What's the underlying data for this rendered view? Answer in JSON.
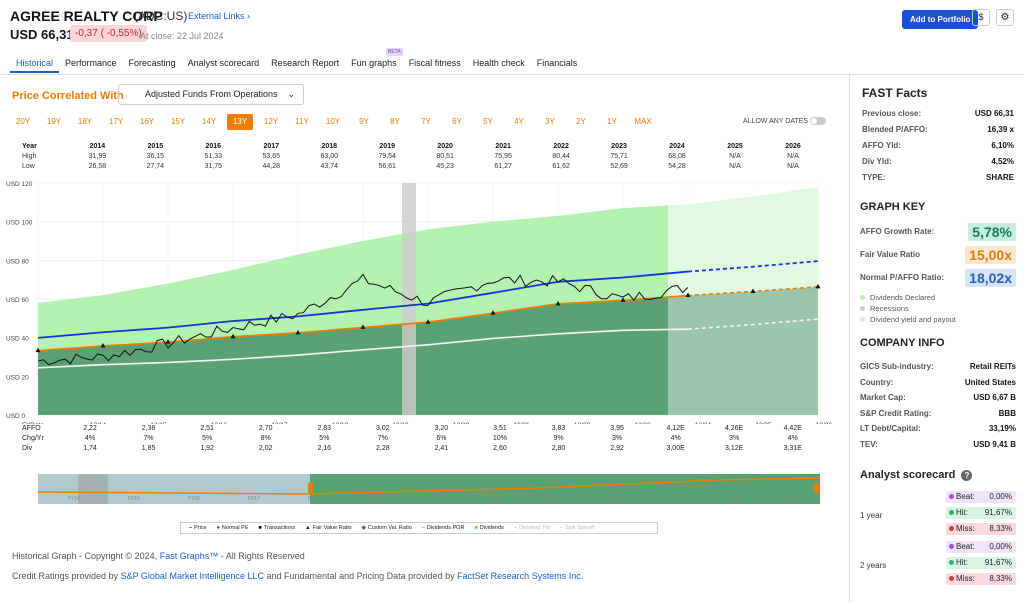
{
  "header": {
    "company": "AGREE REALTY CORP",
    "ticker": "(ADC:US)",
    "external_links": "External Links ›",
    "price": "USD 66,31",
    "change": "-0,37 ( -0,55%)",
    "close": "At close: 22 Jul 2024",
    "add_portfolio": "Add to Portfolio",
    "dollar": "$",
    "gear": "⚙"
  },
  "tabs": [
    {
      "label": "Historical"
    },
    {
      "label": "Performance"
    },
    {
      "label": "Forecasting"
    },
    {
      "label": "Analyst scorecard"
    },
    {
      "label": "Research Report"
    },
    {
      "label": "Fun graphs",
      "badge": "BETA"
    },
    {
      "label": "Fiscal fitness"
    },
    {
      "label": "Health check"
    },
    {
      "label": "Financials"
    }
  ],
  "chartctl": {
    "title": "Price Correlated With",
    "metric": "Adjusted Funds From Operations",
    "years": [
      "20Y",
      "19Y",
      "18Y",
      "17Y",
      "16Y",
      "15Y",
      "14Y",
      "13Y",
      "12Y",
      "11Y",
      "10Y",
      "9Y",
      "8Y",
      "7Y",
      "6Y",
      "5Y",
      "4Y",
      "3Y",
      "2Y",
      "1Y",
      "MAX"
    ],
    "selected": "13Y",
    "allow": "ALLOW ANY DATES"
  },
  "year_table": {
    "labels": [
      "Year",
      "High",
      "Low"
    ],
    "years": [
      "2014",
      "2015",
      "2016",
      "2017",
      "2018",
      "2019",
      "2020",
      "2021",
      "2022",
      "2023",
      "2024",
      "2025",
      "2026"
    ],
    "high": [
      "31,99",
      "36,15",
      "51,33",
      "53,65",
      "63,00",
      "79,54",
      "80,51",
      "75,95",
      "80,44",
      "75,71",
      "68,08",
      "N/A",
      "N/A"
    ],
    "low": [
      "26,58",
      "27,74",
      "31,75",
      "44,28",
      "43,74",
      "56,61",
      "45,23",
      "61,27",
      "61,62",
      "52,69",
      "54,28",
      "N/A",
      "N/A"
    ]
  },
  "chart_data": {
    "type": "line",
    "yaxis": [
      "USD 120",
      "USD 100",
      "USD 80",
      "USD 60",
      "USD 40",
      "USD 20",
      "USD 0"
    ],
    "ylim": [
      0,
      120
    ],
    "fydate_label": "FYDate",
    "fydates": [
      "12/14",
      "12/15",
      "12/16",
      "12/17",
      "12/18",
      "12/19",
      "12/20",
      "12/21",
      "12/22",
      "12/23",
      "12/24",
      "12/25",
      "12/26"
    ],
    "x": [
      2014,
      2015,
      2016,
      2017,
      2018,
      2019,
      2020,
      2021,
      2022,
      2023,
      2024,
      2025,
      2026
    ],
    "series": [
      {
        "name": "Normal PE",
        "values": [
          39.9,
          42.8,
          45.2,
          48.6,
          51.0,
          54.4,
          57.6,
          63.2,
          68.9,
          71.1,
          74.2,
          76.7,
          79.6
        ]
      },
      {
        "name": "Fair Value Ratio",
        "values": [
          33.3,
          35.7,
          37.7,
          40.5,
          42.5,
          45.3,
          48.0,
          52.7,
          57.5,
          59.3,
          61.8,
          63.9,
          66.3
        ]
      },
      {
        "name": "Dividends POR",
        "values": [
          24.4,
          26.0,
          27.2,
          28.8,
          31.0,
          33.7,
          36.3,
          39.6,
          42.0,
          43.8,
          44.4,
          46.8,
          49.6
        ]
      },
      {
        "name": "Price",
        "values": [
          28,
          30,
          37,
          45,
          52,
          70,
          58,
          70,
          69,
          60,
          66
        ]
      },
      {
        "name": "Dividends",
        "values": [
          58,
          62,
          68,
          75,
          83,
          90,
          96,
          100,
          103,
          107,
          109,
          113,
          118
        ]
      }
    ],
    "bottom": {
      "labels": [
        "AFFO",
        "Chg/Yr",
        "Div"
      ],
      "affo": [
        "2,22",
        "2,38",
        "2,51",
        "2,70",
        "2,83",
        "3,02",
        "3,20",
        "3,51",
        "3,83",
        "3,95",
        "4,12E",
        "4,26E",
        "4,42E"
      ],
      "chg": [
        "4%",
        "7%",
        "5%",
        "8%",
        "5%",
        "7%",
        "6%",
        "10%",
        "9%",
        "3%",
        "4%",
        "3%",
        "4%"
      ],
      "div": [
        "1,74",
        "1,85",
        "1,92",
        "2,02",
        "2,16",
        "2,28",
        "2,41",
        "2,60",
        "2,80",
        "2,92",
        "3,00E",
        "3,12E",
        "3,31E"
      ]
    },
    "mini_fy": [
      "FY14",
      "FY15",
      "FY16",
      "FY17",
      "FY18",
      "FY19",
      "FY20",
      "FY21",
      "FY22",
      "FY23",
      "FY24",
      "FY25",
      "FY26"
    ]
  },
  "legend": [
    "Price",
    "Normal PE",
    "Transactions",
    "Fair Value Ratio",
    "Custom Val. Ratio",
    "Dividends POR",
    "Dividends",
    "Dividend Yld",
    "Split Spinoff"
  ],
  "footer": {
    "copy_a": "Historical Graph - Copyright © 2024,",
    "copy_link": "Fast Graphs™",
    "copy_b": "- All Rights Reserved",
    "credit_a": "Credit Ratings provided by",
    "credit_l1": "S&P Global Market Intelligence LLC",
    "credit_b": "and Fundamental and Pricing Data provided by",
    "credit_l2": "FactSet Research Systems Inc."
  },
  "fast_facts": {
    "title": "FAST Facts",
    "rows": [
      {
        "k": "Previous close:",
        "v": "USD 66,31"
      },
      {
        "k": "Blended P/AFFO:",
        "v": "16,39 x"
      },
      {
        "k": "AFFO Yld:",
        "v": "6,10%"
      },
      {
        "k": "Div Yld:",
        "v": "4,52%"
      },
      {
        "k": "TYPE:",
        "v": "SHARE"
      }
    ]
  },
  "graph_key": {
    "title": "GRAPH KEY",
    "rows": [
      {
        "k": "AFFO Growth Rate:",
        "v": "5,78%"
      },
      {
        "k": "Fair Value Ratio",
        "v": "15,00x"
      },
      {
        "k": "Normal P/AFFO Ratio:",
        "v": "18,02x"
      }
    ],
    "legend": [
      "Dividends Declared",
      "Recessions",
      "Dividend yield and payout"
    ]
  },
  "company_info": {
    "title": "COMPANY INFO",
    "rows": [
      {
        "k": "GICS Sub-industry:",
        "v": "Retail REITs"
      },
      {
        "k": "Country:",
        "v": "United States"
      },
      {
        "k": "Market Cap:",
        "v": "USD 6,67 B"
      },
      {
        "k": "S&P Credit Rating:",
        "v": "BBB"
      },
      {
        "k": "LT Debt/Capital:",
        "v": "33,19%"
      },
      {
        "k": "TEV:",
        "v": "USD 9,41 B"
      }
    ]
  },
  "analyst": {
    "title": "Analyst scorecard",
    "help": "?",
    "periods": [
      {
        "label": "1 year",
        "beat": "0,00%",
        "hit": "91,67%",
        "miss": "8,33%"
      },
      {
        "label": "2 years",
        "beat": "0,00%",
        "hit": "91,67%",
        "miss": "8,33%"
      }
    ],
    "beat_l": "Beat:",
    "hit_l": "Hit:",
    "miss_l": "Miss:"
  }
}
